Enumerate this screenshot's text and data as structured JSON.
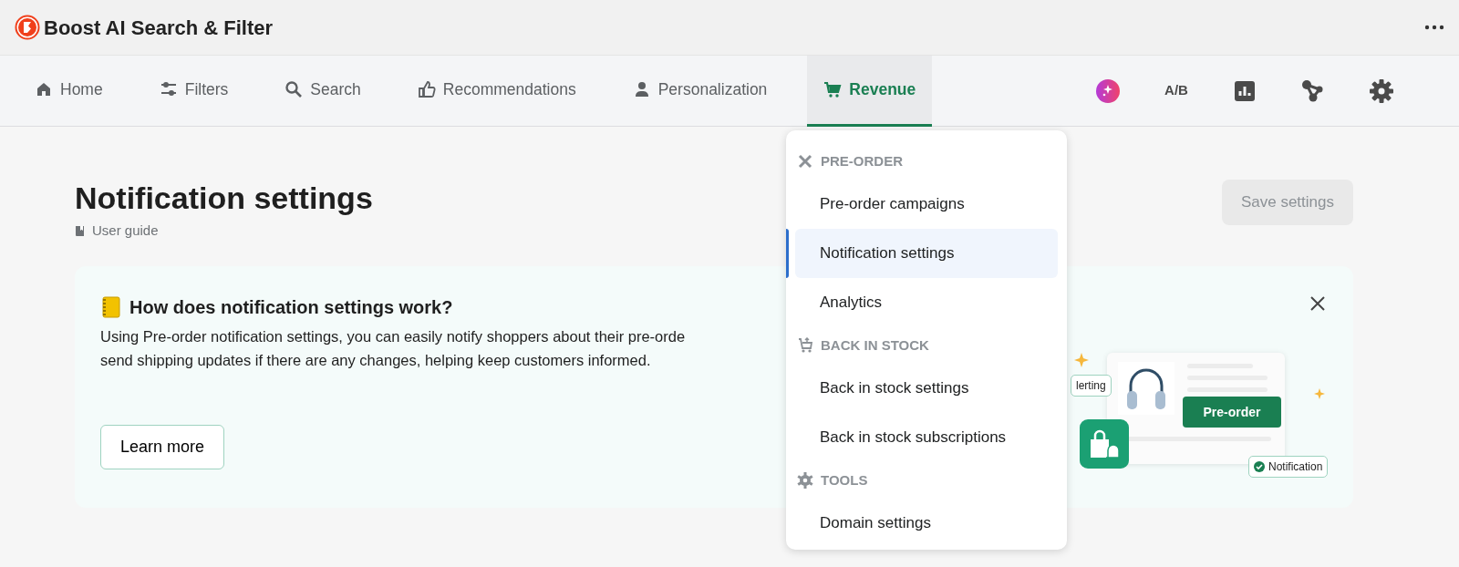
{
  "app": {
    "title": "Boost AI Search & Filter"
  },
  "nav": {
    "items": [
      {
        "label": "Home",
        "kind": "home",
        "selected": false
      },
      {
        "label": "Filters",
        "kind": "sliders",
        "selected": false
      },
      {
        "label": "Search",
        "kind": "search",
        "selected": false
      },
      {
        "label": "Recommendations",
        "kind": "thumb",
        "selected": false
      },
      {
        "label": "Personalization",
        "kind": "person",
        "selected": false
      },
      {
        "label": "Revenue",
        "kind": "cart",
        "selected": true
      }
    ],
    "ab_label": "A/B"
  },
  "page": {
    "title": "Notification settings",
    "guide_link": "User guide",
    "save_button": {
      "label": "Save settings",
      "disabled": true
    }
  },
  "banner": {
    "title": "How does notification settings work?",
    "lines": [
      "Using Pre-order notification settings, you can easily notify shoppers about their pre-orde",
      "send shipping updates if there are any changes, helping keep customers informed."
    ],
    "button": "Learn more",
    "illustration": {
      "chip_left": "lerting",
      "cta": "Pre-order",
      "chip_right": "Notification"
    }
  },
  "dropdown": {
    "sections": [
      {
        "kind": "tools",
        "heading": "PRE-ORDER",
        "items": [
          {
            "label": "Pre-order campaigns",
            "selected": false
          },
          {
            "label": "Notification settings",
            "selected": true
          },
          {
            "label": "Analytics",
            "selected": false
          }
        ]
      },
      {
        "kind": "cart",
        "heading": "BACK IN STOCK",
        "items": [
          {
            "label": "Back in stock settings",
            "selected": false
          },
          {
            "label": "Back in stock subscriptions",
            "selected": false
          }
        ]
      },
      {
        "kind": "gear",
        "heading": "TOOLS",
        "items": [
          {
            "label": "Domain settings",
            "selected": false
          }
        ]
      }
    ]
  }
}
